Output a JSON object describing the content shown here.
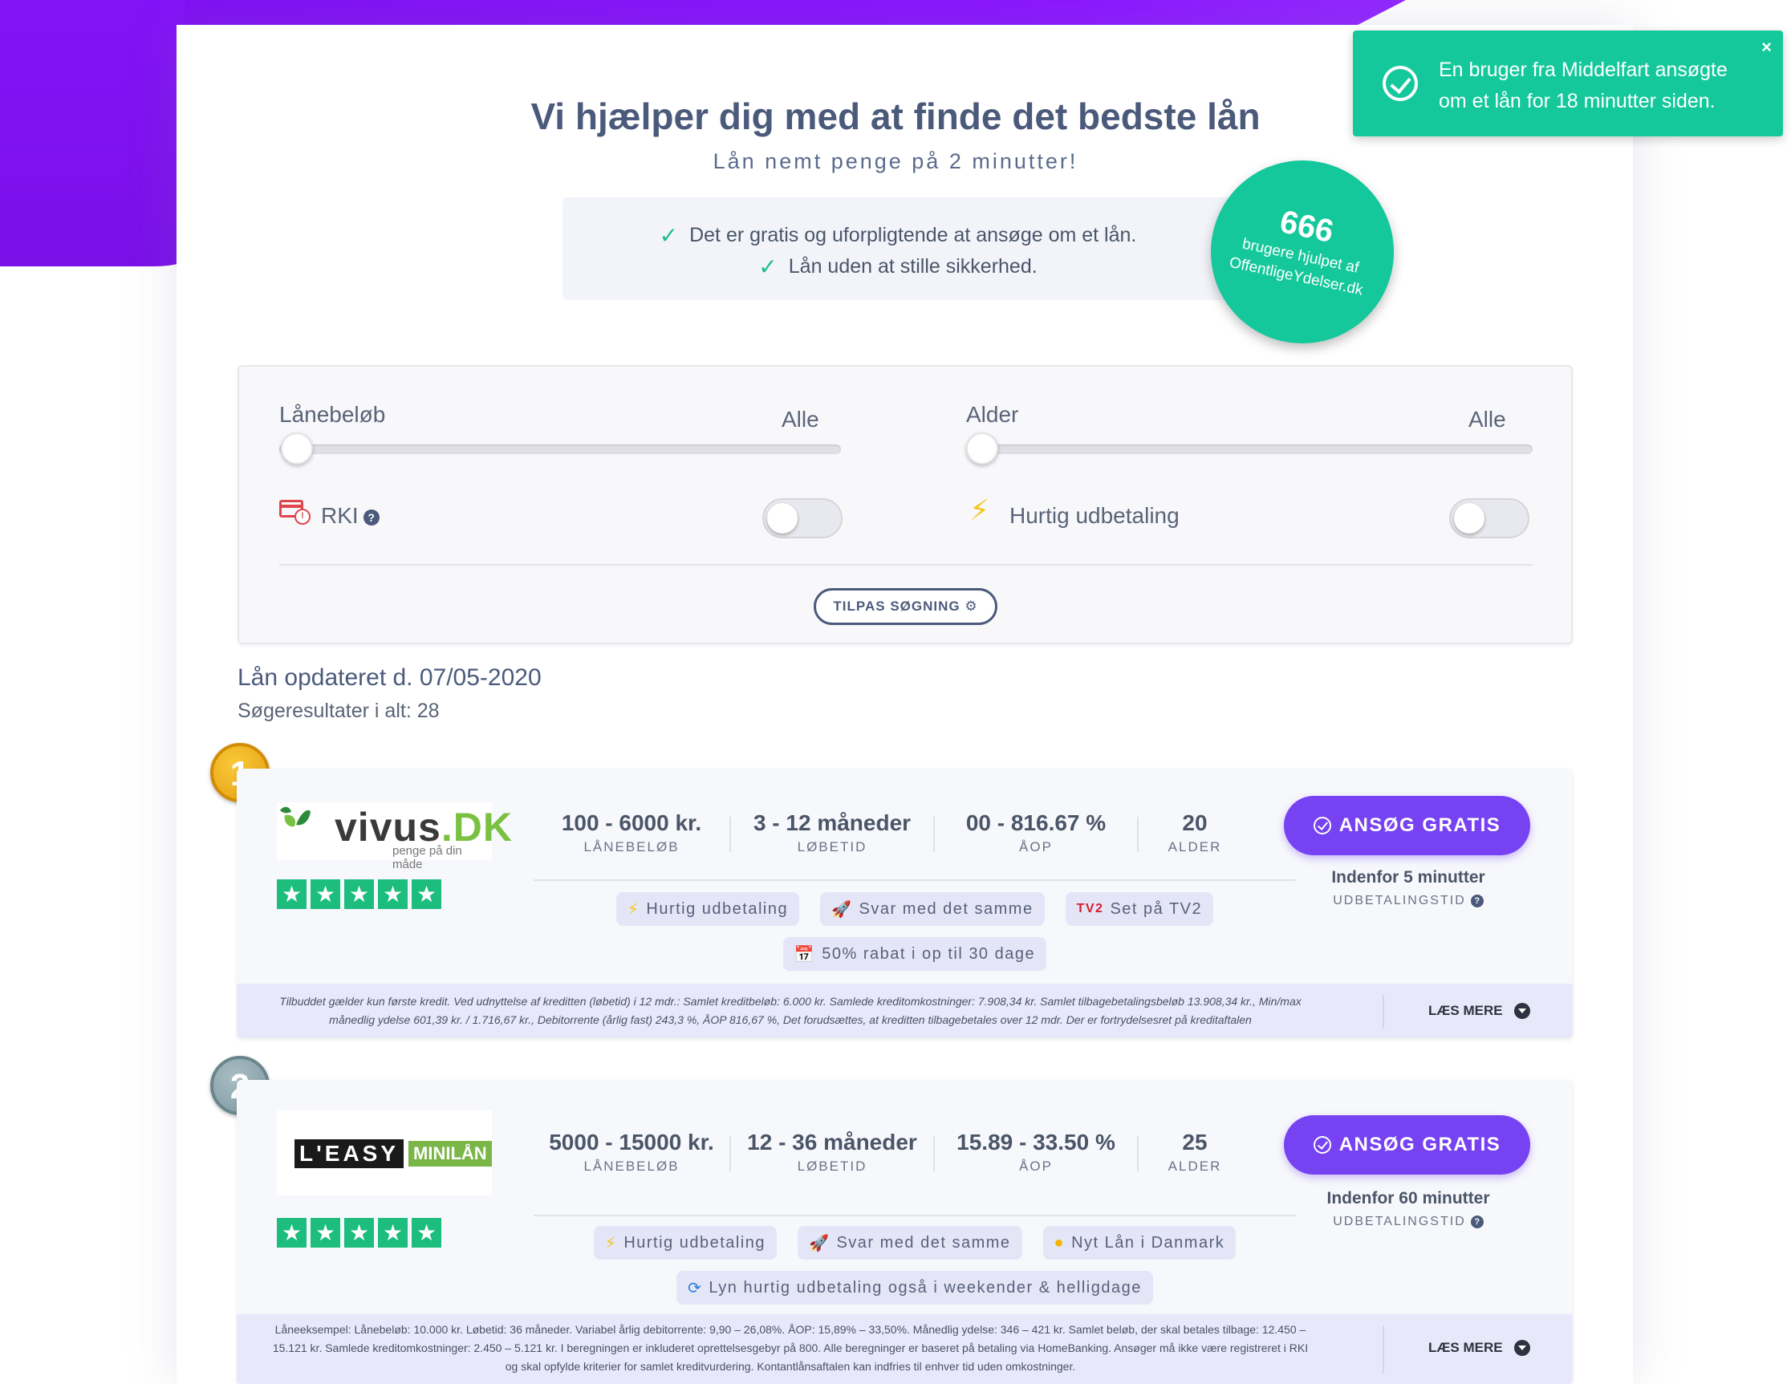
{
  "hero": {
    "title": "Vi hjælper dig med at finde det bedste lån",
    "subtitle": "Lån nemt penge på 2 minutter!",
    "benefits": [
      "Det er gratis og uforpligtende at ansøge om et lån.",
      "Lån uden at stille sikkerhed."
    ]
  },
  "counter": {
    "number": "666",
    "text_line1": "brugere hjulpet af",
    "text_line2": "OffentligeYdelser.dk"
  },
  "toast": {
    "message": "En bruger fra Middelfart ansøgte om et lån for 18 minutter siden.",
    "close": "×"
  },
  "filters": {
    "amount_label": "Lånebeløb",
    "amount_value": "Alle",
    "age_label": "Alder",
    "age_value": "Alle",
    "rki_label": "RKI",
    "fast_payout_label": "Hurtig udbetaling",
    "adjust_button": "TILPAS SØGNING ⚙"
  },
  "results": {
    "updated": "Lån opdateret d. 07/05-2020",
    "count": "Søgeresultater i alt: 28"
  },
  "loans": [
    {
      "rank": "1",
      "logo_main": "vivus",
      "logo_dk": ".DK",
      "logo_tag": "penge på din måde",
      "amount": "100 - 6000 kr.",
      "amount_label": "LÅNEBELØB",
      "term": "3 - 12 måneder",
      "term_label": "LØBETID",
      "apr": "00 - 816.67 %",
      "apr_label": "ÅOP",
      "age": "20",
      "age_label": "ALDER",
      "tags": [
        "Hurtig udbetaling",
        "Svar med det samme",
        "Set på TV2",
        "50% rabat i op til 30 dage"
      ],
      "apply": "ANSØG GRATIS",
      "payout_time": "Indenfor 5 minutter",
      "payout_label": "UDBETALINGSTID",
      "disclaimer": "Tilbuddet gælder kun første kredit. Ved udnyttelse af kreditten (løbetid) i 12 mdr.: Samlet kreditbeløb: 6.000 kr. Samlede kreditomkostninger: 7.908,34 kr. Samlet tilbagebetalingsbeløb 13.908,34 kr., Min/max månedlig ydelse 601,39 kr. / 1.716,67 kr., Debitorrente (årlig fast) 243,3 %, ÅOP 816,67 %, Det forudsættes, at kreditten tilbagebetales over 12 mdr. Der er fortrydelsesret på kreditaftalen",
      "read_more": "LÆS MERE"
    },
    {
      "rank": "2",
      "logo_main": "L'EASY",
      "logo_sub": "MINILÅN",
      "amount": "5000 - 15000 kr.",
      "amount_label": "LÅNEBELØB",
      "term": "12 - 36 måneder",
      "term_label": "LØBETID",
      "apr": "15.89 - 33.50 %",
      "apr_label": "ÅOP",
      "age": "25",
      "age_label": "ALDER",
      "tags": [
        "Hurtig udbetaling",
        "Svar med det samme",
        "Nyt Lån i Danmark",
        "Lyn hurtig udbetaling også i weekender & helligdage"
      ],
      "apply": "ANSØG GRATIS",
      "payout_time": "Indenfor 60 minutter",
      "payout_label": "UDBETALINGSTID",
      "disclaimer": "Låneeksempel: Lånebeløb: 10.000 kr. Løbetid: 36 måneder. Variabel årlig debitorrente: 9,90 – 26,08%. ÅOP: 15,89% – 33,50%. Månedlig ydelse: 346 – 421 kr. Samlet beløb, der skal betales tilbage: 12.450 – 15.121 kr. Samlede kreditomkostninger: 2.450 – 5.121 kr. I beregningen er inkluderet oprettelsesgebyr på 800. Alle beregninger er baseret på betaling via HomeBanking. Ansøger må ikke være registreret i RKI og skal opfylde kriterier for samlet kreditvurdering. Kontantlånsaftalen kan indfries til enhver tid uden omkostninger.",
      "read_more": "LÆS MERE"
    }
  ],
  "colors": {
    "accent": "#7642f2",
    "success": "#14c89b",
    "brand_purple": "#8412f7"
  }
}
